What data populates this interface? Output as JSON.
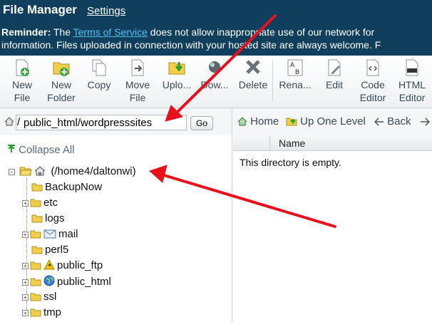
{
  "header": {
    "brand": "File Manager",
    "settings_link": "Settings",
    "reminder_label": "Reminder:",
    "reminder_text_1": " The ",
    "tos_link": "Terms of Service",
    "reminder_text_2": " does not allow inappropriate use of our network for",
    "reminder_text_3": "information. Files uploaded in connection with your hosted site are always welcome. F"
  },
  "toolbar": {
    "new_file": [
      "New",
      "File"
    ],
    "new_folder": [
      "New",
      "Folder"
    ],
    "copy": "Copy",
    "move_file": [
      "Move",
      "File"
    ],
    "upload": "Uplo...",
    "download": "Dow...",
    "delete": "Delete",
    "rename": "Rena...",
    "edit": "Edit",
    "code_editor": [
      "Code",
      "Editor"
    ],
    "html_editor": [
      "HTML",
      "Editor"
    ]
  },
  "pathbar": {
    "slash": "/",
    "path_value": "public_html/wordpresssites",
    "go_label": "Go"
  },
  "nav": {
    "home": "Home",
    "up_one_level": "Up One Level",
    "back": "Back"
  },
  "tree": {
    "collapse_all": "Collapse All",
    "root": "(/home4/daltonwi)",
    "items": [
      "BackupNow",
      "etc",
      "logs",
      "mail",
      "perl5",
      "public_ftp",
      "public_html",
      "ssl",
      "tmp"
    ]
  },
  "files": {
    "column_name": "Name",
    "empty_message": "This directory is empty."
  },
  "colors": {
    "header_bg": "#0f3f5c",
    "link": "#4fc3f7",
    "arrow": "#e8101a"
  }
}
